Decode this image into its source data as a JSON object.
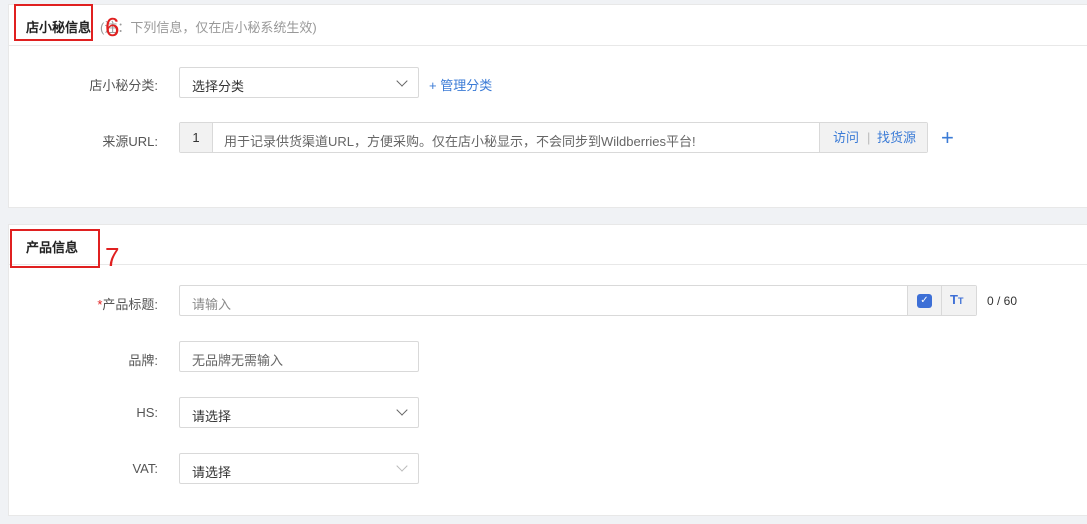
{
  "store_section": {
    "title": "店小秘信息",
    "note": "(注：下列信息，仅在店小秘系统生效)",
    "marker": "6",
    "category": {
      "label": "店小秘分类:",
      "value": "选择分类",
      "manage_link": "+ 管理分类"
    },
    "source_url": {
      "label": "来源URL:",
      "index": "1",
      "placeholder": "用于记录供货渠道URL，方便采购。仅在店小秘显示，不会同步到Wildberries平台!",
      "visit": "访问",
      "separator": "|",
      "find_supply": "找货源",
      "add": "+"
    }
  },
  "product_section": {
    "title": "产品信息",
    "marker": "7",
    "product_title": {
      "required_mark": "*",
      "label": "产品标题:",
      "placeholder": "请输入",
      "counter": "0 / 60",
      "icon_translate": "translate-icon",
      "icon_font_case": "font-case-icon"
    },
    "brand": {
      "label": "品牌:",
      "placeholder": "无品牌无需输入"
    },
    "hs": {
      "label": "HS:",
      "placeholder": "请选择"
    },
    "vat": {
      "label": "VAT:",
      "placeholder": "请选择"
    }
  },
  "colors": {
    "accent": "#3b7bd6",
    "annotation": "#e02020"
  }
}
